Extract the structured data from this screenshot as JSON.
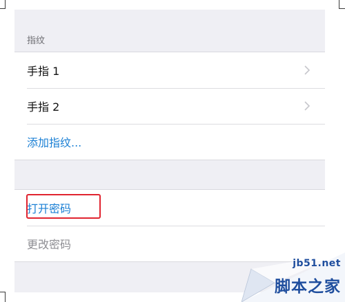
{
  "fingerprint_section": {
    "header": "指纹",
    "fingers": [
      {
        "label": "手指 1"
      },
      {
        "label": "手指 2"
      }
    ],
    "add_label": "添加指纹..."
  },
  "passcode_section": {
    "turn_on_label": "打开密码",
    "change_label": "更改密码"
  },
  "watermark": {
    "site": "jb51.net",
    "name": "脚本之家"
  },
  "colors": {
    "link": "#1a7fd4",
    "highlight": "#e0232f",
    "muted": "#8e8e93",
    "background": "#efeff4"
  }
}
